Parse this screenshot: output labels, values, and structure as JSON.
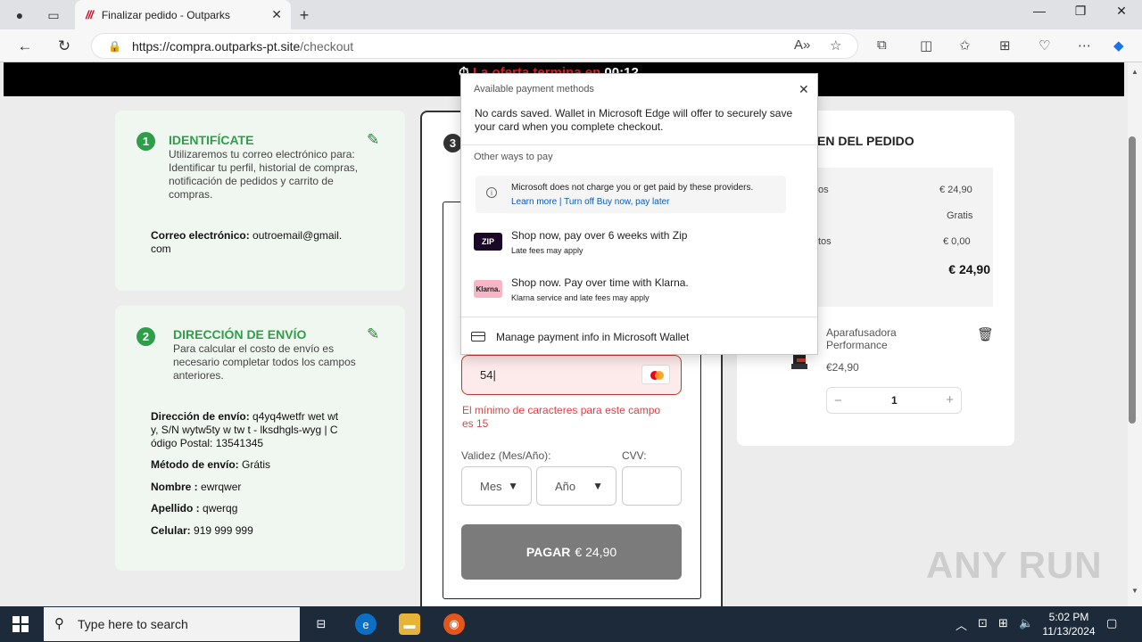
{
  "browser": {
    "tab_title": "Finalizar pedido - Outparks",
    "url_domain": "https://compra.outparks-pt.site",
    "url_path": "/checkout"
  },
  "promo": {
    "text": "La oferta termina en",
    "timer": "00:12"
  },
  "step1": {
    "number": "1",
    "title": "IDENTIFÍCATE",
    "description": "Utilizaremos tu correo electrónico para: Identificar tu perfil, historial de compras, notificación de pedidos y carrito de compras.",
    "email_label": "Correo electrónico:",
    "email_value_l1": "outroemail@gmail.",
    "email_value_l2": "com"
  },
  "step2": {
    "number": "2",
    "title": "DIRECCIÓN DE ENVÍO",
    "description": "Para calcular el costo de envío es necesario completar todos los campos anteriores.",
    "address_label": "Dirección de envío:",
    "address_l1": "q4yq4wetfr wet wt",
    "address_l2": "y, S/N wytw5ty w tw t - lksdhgls-wyg | C",
    "address_l3": "ódigo Postal: 13541345",
    "shipping_label": "Método de envío:",
    "shipping_value": "Grátis",
    "name_label": "Nombre :",
    "name_value": "ewrqwer",
    "surname_label": "Apellido :",
    "surname_value": "qwerqg",
    "phone_label": "Celular:",
    "phone_value": "919 999 999"
  },
  "step3": {
    "number": "3",
    "card_number_value": "54",
    "error": "El mínimo de caracteres para este campo es 15",
    "validity_label": "Validez (Mes/Año):",
    "cvv_label": "CVV:",
    "month_placeholder": "Mes",
    "year_placeholder": "Año",
    "pay_label": "PAGAR",
    "pay_amount": "€ 24,90"
  },
  "summary": {
    "title": "EN DEL PEDIDO",
    "row1_label": "os",
    "row1_value": "€ 24,90",
    "row2_value": "Gratis",
    "row3_label": "tos",
    "row3_value": "€ 0,00",
    "total": "€ 24,90",
    "product_name": "Aparafusadora Performance",
    "product_price": "€24,90",
    "quantity": "1"
  },
  "wallet_popup": {
    "header": "Available payment methods",
    "no_cards": "No cards saved. Wallet in Microsoft Edge will offer to securely save your card when you complete checkout.",
    "other_ways": "Other ways to pay",
    "notice": "Microsoft does not charge you or get paid by these providers.",
    "notice_link": "Learn more | Turn off Buy now, pay later",
    "zip_logo": "ZIP",
    "zip_title": "Shop now, pay over 6 weeks with Zip",
    "zip_sub": "Late fees may apply",
    "klarna_logo": "Klarna.",
    "klarna_title": "Shop now. Pay over time with Klarna.",
    "klarna_sub": "Klarna service and late fees may apply",
    "manage": "Manage payment info in Microsoft Wallet"
  },
  "taskbar": {
    "search_placeholder": "Type here to search",
    "time": "5:02 PM",
    "date": "11/13/2024"
  },
  "watermark": "ANY RUN"
}
